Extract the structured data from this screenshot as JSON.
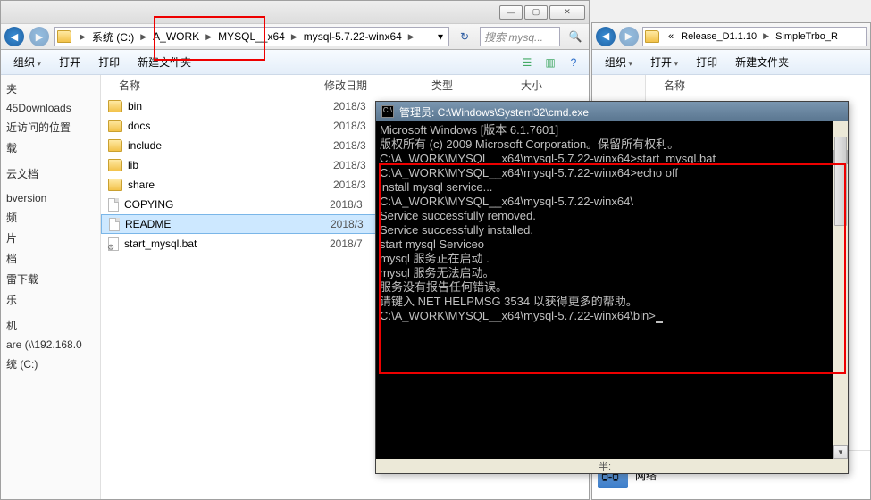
{
  "left_window": {
    "win_buttons": {
      "min": "—",
      "max": "▢",
      "close": "✕"
    },
    "breadcrumb": [
      "系统 (C:)",
      "A_WORK",
      "MYSQL__x64",
      "mysql-5.7.22-winx64"
    ],
    "search_placeholder": "搜索 mysq...",
    "toolbar": {
      "organize": "组织",
      "open": "打开",
      "print": "打印",
      "new_folder": "新建文件夹"
    },
    "columns": {
      "name": "名称",
      "date": "修改日期",
      "type": "类型",
      "size": "大小"
    },
    "nav": [
      "夹",
      "45Downloads",
      "近访问的位置",
      "载",
      "",
      "云文档",
      "",
      "bversion",
      "频",
      "片",
      "档",
      "雷下载",
      "乐",
      "",
      "机",
      "are (\\\\192.168.0",
      "统 (C:)"
    ],
    "files": [
      {
        "name": "bin",
        "date": "2018/3",
        "kind": "folder"
      },
      {
        "name": "docs",
        "date": "2018/3",
        "kind": "folder"
      },
      {
        "name": "include",
        "date": "2018/3",
        "kind": "folder"
      },
      {
        "name": "lib",
        "date": "2018/3",
        "kind": "folder"
      },
      {
        "name": "share",
        "date": "2018/3",
        "kind": "folder"
      },
      {
        "name": "COPYING",
        "date": "2018/3",
        "kind": "file"
      },
      {
        "name": "README",
        "date": "2018/3",
        "kind": "file",
        "sel": true
      },
      {
        "name": "start_mysql.bat",
        "date": "2018/7",
        "kind": "bat"
      }
    ]
  },
  "right_window": {
    "breadcrumb": [
      "«",
      "Release_D1.1.10",
      "SimpleTrbo_R"
    ],
    "toolbar": {
      "organize": "组织",
      "open": "打开",
      "print": "打印",
      "new_folder": "新建文件夹"
    },
    "col_name": "名称",
    "bottom_label": "网络"
  },
  "cmd": {
    "title": "管理员: C:\\Windows\\System32\\cmd.exe",
    "lines": [
      "Microsoft Windows [版本 6.1.7601]",
      "版权所有 (c) 2009 Microsoft Corporation。保留所有权利。",
      "",
      "C:\\A_WORK\\MYSQL__x64\\mysql-5.7.22-winx64>start_mysql.bat",
      "",
      "C:\\A_WORK\\MYSQL__x64\\mysql-5.7.22-winx64>echo off",
      "install mysql service...",
      "C:\\A_WORK\\MYSQL__x64\\mysql-5.7.22-winx64\\",
      "Service successfully removed.",
      "Service successfully installed.",
      "start mysql Serviceo",
      "mysql 服务正在启动 .",
      "mysql 服务无法启动。",
      "",
      "服务没有报告任何错误。",
      "",
      "请键入 NET HELPMSG 3534 以获得更多的帮助。",
      "",
      "",
      "C:\\A_WORK\\MYSQL__x64\\mysql-5.7.22-winx64\\bin>"
    ],
    "hscroll_label": "半:"
  }
}
